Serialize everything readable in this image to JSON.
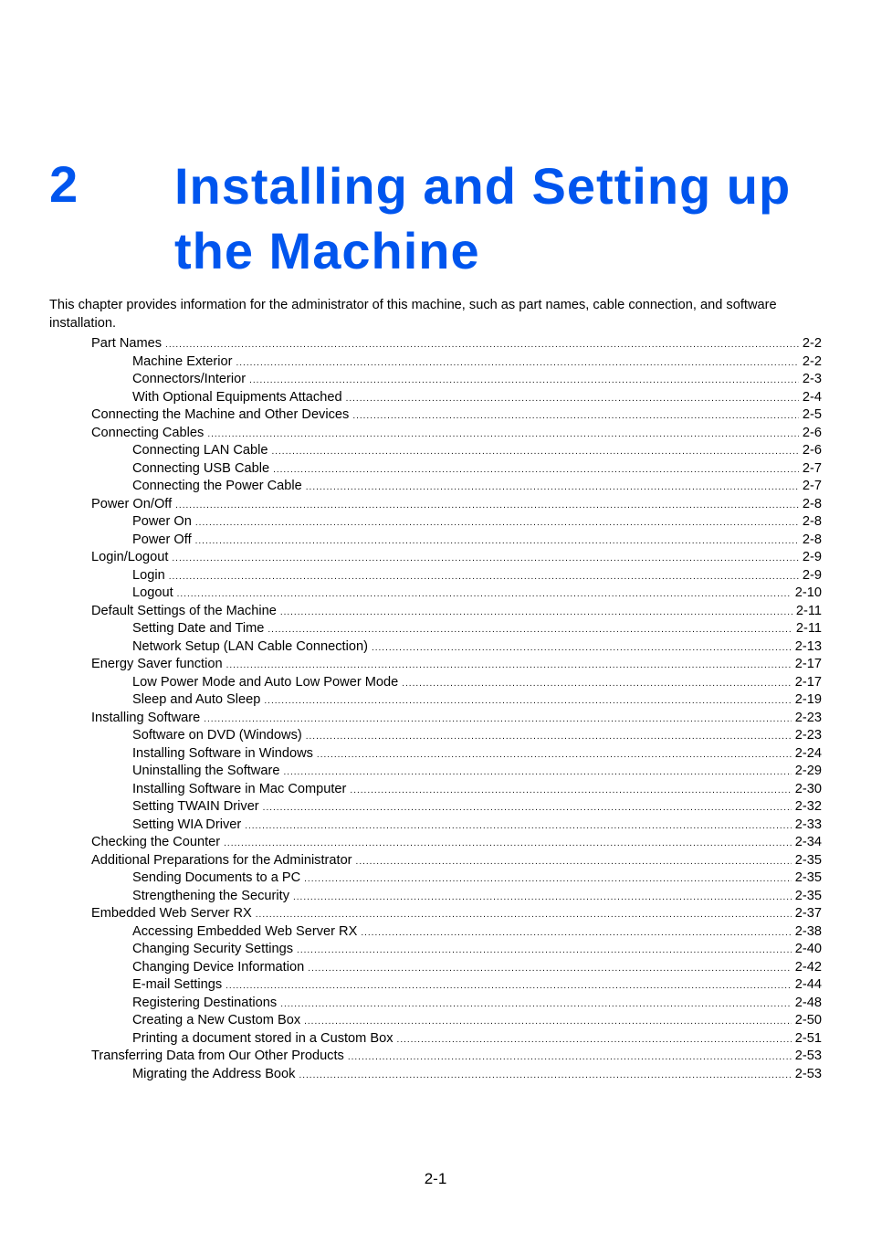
{
  "chapter": {
    "number": "2",
    "title": "Installing and Setting up the Machine",
    "title_color": "#0055ee"
  },
  "intro": "This chapter provides information for the administrator of this machine, such as part names, cable connection, and software installation.",
  "toc": [
    {
      "level": 1,
      "title": "Part Names",
      "page": "2-2"
    },
    {
      "level": 2,
      "title": "Machine Exterior",
      "page": "2-2"
    },
    {
      "level": 2,
      "title": "Connectors/Interior",
      "page": "2-3"
    },
    {
      "level": 2,
      "title": "With Optional Equipments Attached",
      "page": "2-4"
    },
    {
      "level": 1,
      "title": "Connecting the Machine and Other Devices",
      "page": "2-5"
    },
    {
      "level": 1,
      "title": "Connecting Cables",
      "page": "2-6"
    },
    {
      "level": 2,
      "title": "Connecting LAN Cable",
      "page": "2-6"
    },
    {
      "level": 2,
      "title": "Connecting USB Cable",
      "page": "2-7"
    },
    {
      "level": 2,
      "title": "Connecting the Power Cable",
      "page": "2-7"
    },
    {
      "level": 1,
      "title": "Power On/Off",
      "page": "2-8"
    },
    {
      "level": 2,
      "title": "Power On",
      "page": "2-8"
    },
    {
      "level": 2,
      "title": "Power Off",
      "page": "2-8"
    },
    {
      "level": 1,
      "title": "Login/Logout",
      "page": "2-9"
    },
    {
      "level": 2,
      "title": "Login",
      "page": "2-9"
    },
    {
      "level": 2,
      "title": "Logout",
      "page": "2-10"
    },
    {
      "level": 1,
      "title": "Default Settings of the Machine",
      "page": "2-11"
    },
    {
      "level": 2,
      "title": "Setting Date and Time",
      "page": "2-11"
    },
    {
      "level": 2,
      "title": "Network Setup (LAN Cable Connection)",
      "page": "2-13"
    },
    {
      "level": 1,
      "title": "Energy Saver function",
      "page": "2-17"
    },
    {
      "level": 2,
      "title": "Low Power Mode and Auto Low Power Mode",
      "page": "2-17"
    },
    {
      "level": 2,
      "title": "Sleep and Auto Sleep",
      "page": "2-19"
    },
    {
      "level": 1,
      "title": "Installing Software",
      "page": "2-23"
    },
    {
      "level": 2,
      "title": "Software on DVD (Windows)",
      "page": "2-23"
    },
    {
      "level": 2,
      "title": "Installing Software in Windows",
      "page": "2-24"
    },
    {
      "level": 2,
      "title": "Uninstalling the Software",
      "page": "2-29"
    },
    {
      "level": 2,
      "title": "Installing Software in Mac Computer",
      "page": "2-30"
    },
    {
      "level": 2,
      "title": "Setting TWAIN Driver",
      "page": "2-32"
    },
    {
      "level": 2,
      "title": "Setting WIA Driver",
      "page": "2-33"
    },
    {
      "level": 1,
      "title": "Checking the Counter",
      "page": "2-34"
    },
    {
      "level": 1,
      "title": "Additional Preparations for the Administrator",
      "page": "2-35"
    },
    {
      "level": 2,
      "title": "Sending Documents to a PC",
      "page": "2-35"
    },
    {
      "level": 2,
      "title": "Strengthening the Security",
      "page": "2-35"
    },
    {
      "level": 1,
      "title": "Embedded Web Server RX",
      "page": "2-37"
    },
    {
      "level": 2,
      "title": "Accessing Embedded Web Server RX",
      "page": "2-38"
    },
    {
      "level": 2,
      "title": "Changing Security Settings",
      "page": "2-40"
    },
    {
      "level": 2,
      "title": "Changing Device Information",
      "page": "2-42"
    },
    {
      "level": 2,
      "title": "E-mail Settings",
      "page": "2-44"
    },
    {
      "level": 2,
      "title": "Registering Destinations",
      "page": "2-48"
    },
    {
      "level": 2,
      "title": "Creating a New Custom Box",
      "page": "2-50"
    },
    {
      "level": 2,
      "title": "Printing a document stored in a Custom Box",
      "page": "2-51"
    },
    {
      "level": 1,
      "title": "Transferring Data from Our Other Products",
      "page": "2-53"
    },
    {
      "level": 2,
      "title": "Migrating the Address Book",
      "page": "2-53"
    }
  ],
  "footer": {
    "page_number": "2-1"
  }
}
